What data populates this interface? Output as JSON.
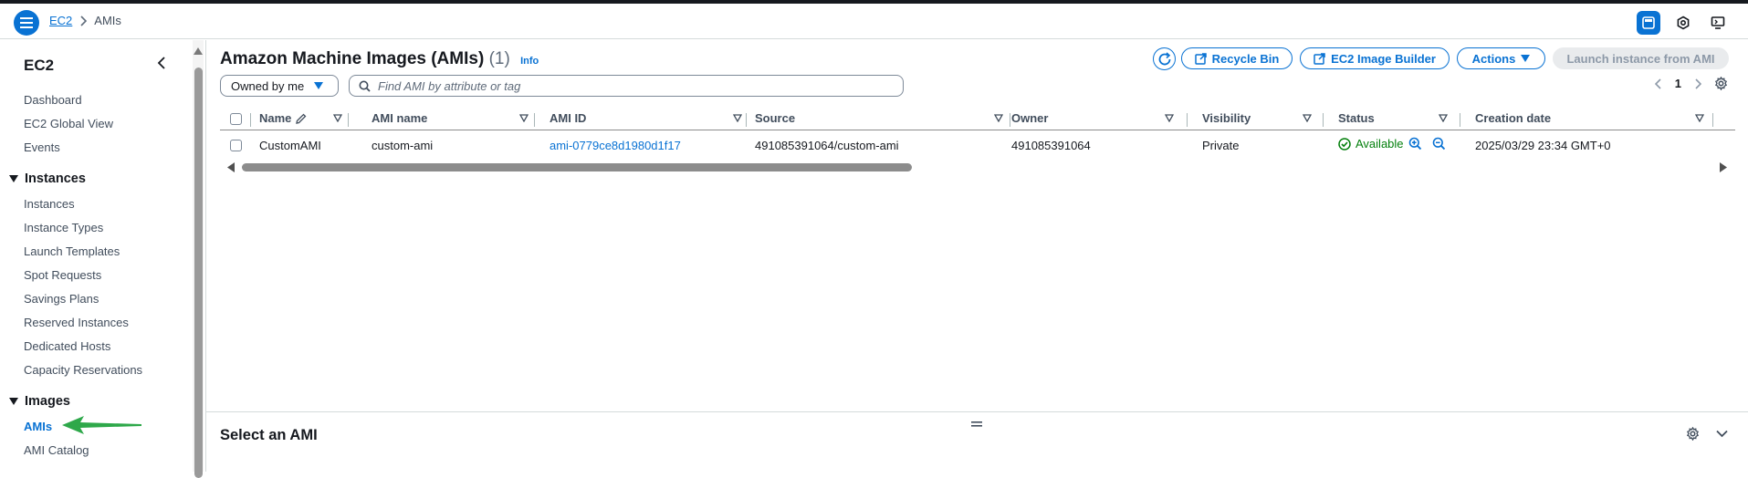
{
  "breadcrumb": {
    "root": "EC2",
    "current": "AMIs"
  },
  "sidebar": {
    "title": "EC2",
    "top_items": [
      "Dashboard",
      "EC2 Global View",
      "Events"
    ],
    "instances_section": "Instances",
    "instances_items": [
      "Instances",
      "Instance Types",
      "Launch Templates",
      "Spot Requests",
      "Savings Plans",
      "Reserved Instances",
      "Dedicated Hosts",
      "Capacity Reservations"
    ],
    "images_section": "Images",
    "images_items": [
      "AMIs",
      "AMI Catalog"
    ]
  },
  "main": {
    "title": "Amazon Machine Images (AMIs)",
    "count": "(1)",
    "info": "Info",
    "buttons": {
      "recycle_bin": "Recycle Bin",
      "image_builder": "EC2 Image Builder",
      "actions": "Actions",
      "launch": "Launch instance from AMI"
    },
    "owner_filter": "Owned by me",
    "search_placeholder": "Find AMI by attribute or tag",
    "page_number": "1",
    "columns": [
      "Name",
      "AMI name",
      "AMI ID",
      "Source",
      "Owner",
      "Visibility",
      "Status",
      "Creation date"
    ],
    "row": {
      "name": "CustomAMI",
      "ami_name": "custom-ami",
      "ami_id": "ami-0779ce8d1980d1f17",
      "source": "491085391064/custom-ami",
      "owner": "491085391064",
      "visibility": "Private",
      "status": "Available",
      "creation_date": "2025/03/29 23:34 GMT+0"
    },
    "details_title": "Select an AMI"
  },
  "colors": {
    "primary": "#0972d3",
    "success": "#037f0c",
    "annotation_arrow": "#2ea84a"
  }
}
